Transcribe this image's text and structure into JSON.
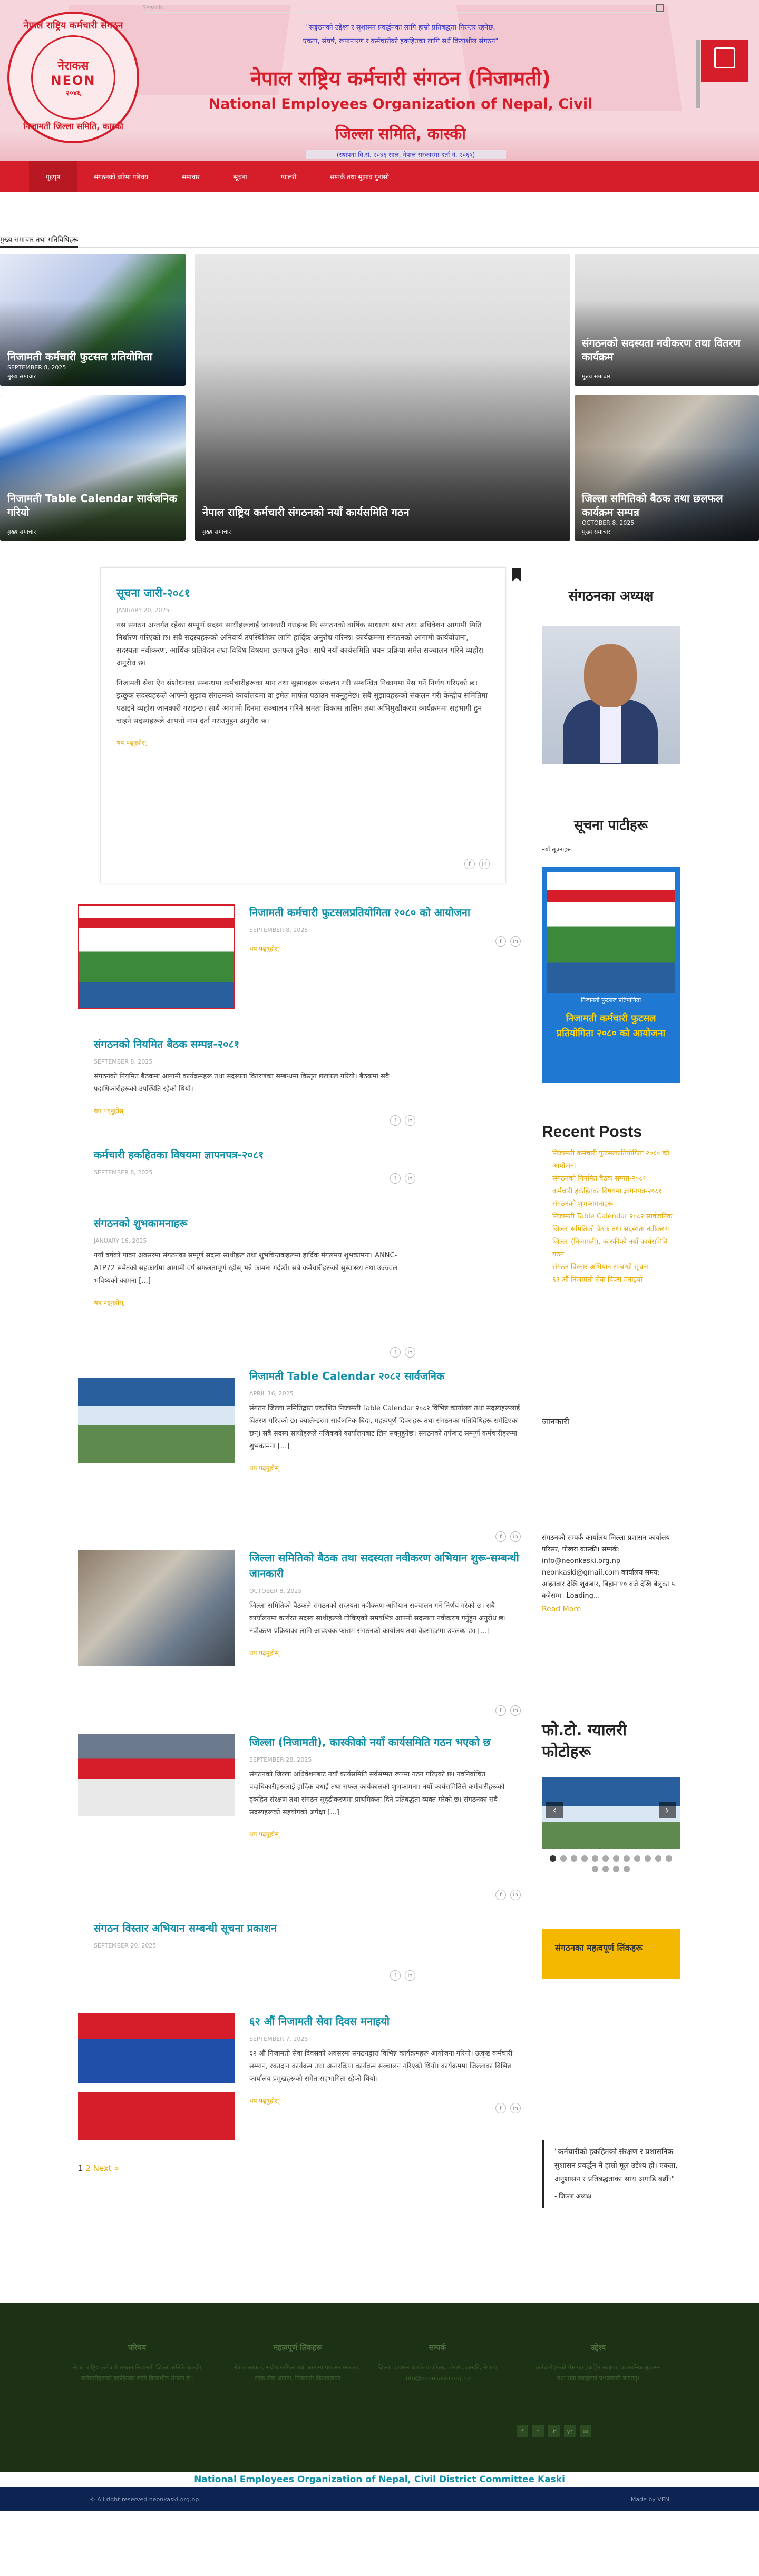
{
  "header": {
    "search_placeholder": "Search...",
    "logo": {
      "ring_top": "नेपाल राष्ट्रिय कर्मचारी संगठन",
      "abbr": "नेराकस",
      "neon": "NEON",
      "year": "२०४६",
      "ring_bottom": "निजामती जिल्ला समिति, कास्की"
    },
    "slogan_line1": "\"सङ्गठनको उद्देश्य र सुशासन प्रवर्द्धनका लागि हाम्रो प्रतिबद्धता निरन्तर रहनेछ,",
    "slogan_line2": "एकता, संघर्ष, रूपान्तरण र कर्मचारीको हकहितका लागि सधैँ क्रियाशील संगठन\"",
    "title_np": "नेपाल राष्ट्रिय कर्मचारी संगठन (निजामती)",
    "title_en": "National Employees Organization of Nepal, Civil",
    "title_sub": "जिल्ला समिति, कास्की",
    "estd": "(स्थापना वि.सं. २०४६ साल, नेपाल सरकारमा दर्ता नं. २०६५)"
  },
  "nav": [
    "गृहपृष्ठ",
    "संगठनको बारेमा परिचय",
    "समाचार",
    "सूचना",
    "ग्यालरी",
    "सम्पर्क तथा सुझाव गुनासो"
  ],
  "featured": {
    "section_title": "मुख्य समाचार तथा गतिविधिहरू",
    "cards": [
      {
        "title": "निजामती कर्मचारी फुटसल प्रतियोगिता",
        "date": "SEPTEMBER 8, 2025",
        "cat": "मुख्य समाचार"
      },
      {
        "title": "निजामती Table Calendar सार्वजनिक गरियो",
        "date": "",
        "cat": "मुख्य समाचार"
      },
      {
        "title": "नेपाल राष्ट्रिय कर्मचारी संगठनको नयाँ कार्यसमिति गठन",
        "date": "",
        "cat": "मुख्य समाचार"
      },
      {
        "title": "संगठनको सदस्यता नवीकरण तथा वितरण कार्यक्रम",
        "date": "",
        "cat": "मुख्य समाचार"
      },
      {
        "title": "जिल्ला समितिको बैठक तथा छलफल कार्यक्रम सम्पन्न",
        "date": "OCTOBER 8, 2025",
        "cat": "मुख्य समाचार"
      }
    ]
  },
  "lead": {
    "title": "सूचना जारी-२०८१",
    "date": "JANUARY 20, 2025",
    "para1": "यस संगठन अन्तर्गत रहेका सम्पूर्ण सदस्य साथीहरूलाई जानकारी गराइन्छ कि संगठनको वार्षिक साधारण सभा तथा अधिवेशन आगामी मिति निर्धारण गरिएको छ। सबै सदस्यहरूको अनिवार्य उपस्थितिका लागि हार्दिक अनुरोध गरिन्छ। कार्यक्रममा संगठनको आगामी कार्ययोजना, सदस्यता नवीकरण, आर्थिक प्रतिवेदन तथा विविध विषयमा छलफल हुनेछ। साथै नयाँ कार्यसमिति चयन प्रक्रिया समेत सञ्चालन गरिने व्यहोरा अनुरोध छ।",
    "para2": "निजामती सेवा ऐन संशोधनका सम्बन्धमा कर्मचारीहरूका माग तथा सुझावहरू संकलन गरी सम्बन्धित निकायमा पेस गर्ने निर्णय गरिएको छ। इच्छुक सदस्यहरूले आफ्नो सुझाव संगठनको कार्यालयमा वा इमेल मार्फत पठाउन सक्नुहुनेछ। सबै सुझावहरूको संकलन गरी केन्द्रीय समितिमा पठाइने व्यहोरा जानकारी गराइन्छ। साथै आगामी दिनमा सञ्चालन गरिने क्षमता विकास तालिम तथा अभिमुखीकरण कार्यक्रममा सहभागी हुन चाहने सदस्यहरूले आफ्नो नाम दर्ता गराउनुहुन अनुरोध छ।",
    "more": "थप पढ्नुहोस्"
  },
  "posts": [
    {
      "title": "निजामती कर्मचारी फुटसलप्रतियोगिता २०८० को आयोजना",
      "date": "SEPTEMBER 8, 2025",
      "excerpt": "",
      "more": "थप पढ्नुहोस्"
    },
    {
      "title": "संगठनको नियमित बैठक सम्पन्न-२०८१",
      "date": "SEPTEMBER 8, 2025",
      "excerpt": "संगठनको नियमित बैठकमा आगामी कार्यक्रमहरू तथा सदस्यता वितरणका सम्बन्धमा विस्तृत छलफल गरियो। बैठकमा सबै पदाधिकारीहरूको उपस्थिति रहेको थियो।",
      "more": "थप पढ्नुहोस्"
    },
    {
      "title": "कर्मचारी हकहितका विषयमा ज्ञापनपत्र-२०८१",
      "date": "SEPTEMBER 8, 2025",
      "excerpt": "",
      "more": ""
    },
    {
      "title": "संगठनको शुभकामनाहरू",
      "date": "JANUARY 16, 2025",
      "excerpt": "नयाँ वर्षको पावन अवसरमा संगठनका सम्पूर्ण सदस्य साथीहरू तथा शुभचिन्तकहरूमा हार्दिक मंगलमय शुभकामना। ANNC- ATP72 समेतको सहकार्यमा आगामी वर्ष सफलतापूर्ण रहोस् भन्ने कामना गर्दछौं। सबै कर्मचारीहरूको सुस्वास्थ्य तथा उज्ज्वल भविष्यको कामना [...]",
      "more": "थप पढ्नुहोस्"
    },
    {
      "title": "निजामती Table Calendar २०८२ सार्वजनिक",
      "date": "APRIL 16, 2025",
      "excerpt": "संगठन जिल्ला समितिद्वारा प्रकाशित निजामती Table Calendar २०८२ विभिन्न कार्यालय तथा सदस्यहरूलाई वितरण गरिएको छ। क्यालेन्डरमा सार्वजनिक बिदा, महत्वपूर्ण दिवसहरू तथा संगठनका गतिविधिहरू समेटिएका छन्। सबै सदस्य साथीहरूले नजिकको कार्यालयबाट लिन सक्नुहुनेछ। संगठनको तर्फबाट सम्पूर्ण कर्मचारीहरूमा शुभकामना [...]",
      "more": "थप पढ्नुहोस्"
    },
    {
      "title": "जिल्ला समितिको बैठक तथा सदस्यता नवीकरण अभियान शुरू-सम्बन्धी जानकारी",
      "date": "OCTOBER 8, 2025",
      "excerpt": "जिल्ला समितिको बैठकले संगठनको सदस्यता नवीकरण अभियान सञ्चालन गर्ने निर्णय गरेको छ। सबै कार्यालयमा कार्यरत सदस्य साथीहरूले तोकिएको समयभित्र आफ्नो सदस्यता नवीकरण गर्नुहुन अनुरोध छ। नवीकरण प्रक्रियाका लागि आवश्यक फाराम संगठनको कार्यालय तथा वेबसाइटमा उपलब्ध छ। [...]",
      "more": "थप पढ्नुहोस्"
    },
    {
      "title": "जिल्ला (निजामती), कास्कीको नयाँ कार्यसमिति गठन भएको छ",
      "date": "SEPTEMBER 28, 2025",
      "excerpt": "संगठनको जिल्ला अधिवेशनबाट नयाँ कार्यसमिति सर्वसम्मत रूपमा गठन गरिएको छ। नवनिर्वाचित पदाधिकारीहरूलाई हार्दिक बधाई तथा सफल कार्यकालको शुभकामना। नयाँ कार्यसमितिले कर्मचारीहरूको हकहित संरक्षण तथा संगठन सुदृढीकरणमा प्राथमिकता दिने प्रतिबद्धता व्यक्त गरेको छ। संगठनका सबै सदस्यहरूको सहयोगको अपेक्षा [...]",
      "more": "थप पढ्नुहोस्"
    },
    {
      "title": "संगठन विस्तार अभियान सम्बन्धी सूचना प्रकाशन",
      "date": "SEPTEMBER 20, 2025",
      "excerpt": "",
      "more": ""
    },
    {
      "title": "६२ औं निजामती सेवा दिवस मनाइयो",
      "date": "SEPTEMBER 7, 2025",
      "excerpt": "६२ औं निजामती सेवा दिवसको अवसरमा संगठनद्वारा विभिन्न कार्यक्रमहरू आयोजना गरियो। उत्कृष्ट कर्मचारी सम्मान, रक्तदान कार्यक्रम तथा अन्तरक्रिया कार्यक्रम सञ्चालन गरिएको थियो। कार्यक्रममा जिल्लाका विभिन्न कार्यालय प्रमुखहरूको समेत सहभागिता रहेको थियो।",
      "more": "थप पढ्नुहोस्"
    }
  ],
  "pagination": {
    "p1": "1",
    "p2": "2",
    "next": "Next »"
  },
  "sidebar": {
    "president_heading": "संगठनका अध्यक्ष",
    "notice_heading": "सूचना पाटीहरू",
    "notice_sub": "नयाँ सूचनाहरू",
    "ad_text": "निजामती कर्मचारी फुटसल प्रतियोगिता २०८० को आयोजना",
    "ad_sub": "निजामती फुटसल प्रतियोगिता",
    "recent_heading": "Recent Posts",
    "recent": [
      "निजामती कर्मचारी फुटसलप्रतियोगिता २०८० को आयोजना",
      "संगठनको नियमित बैठक सम्पन्न-२०८१",
      "कर्मचारी हकहितका विषयमा ज्ञापनपत्र-२०८१",
      "संगठनको शुभकामनाहरू",
      "निजामती Table Calendar २०८२ सार्वजनिक",
      "जिल्ला समितिको बैठक तथा सदस्यता नवीकरण",
      "जिल्ला (निजामती), कास्कीको नयाँ कार्यसमिति गठन",
      "संगठन विस्तार अभियान सम्बन्धी सूचना",
      "६२ औं निजामती सेवा दिवस मनाइयो"
    ],
    "info_heading": "जानकारी",
    "info_text": "संगठनको सम्पर्क कार्यालय जिल्ला प्रशासन कार्यालय परिसर, पोखरा कास्की। सम्पर्क: info@neonkaski.org.np neonkaski@gmail.com कार्यालय समय: आइतबार देखि शुक्रबार, बिहान १० बजे देखि बेलुका ५ बजेसम्म। Loading...",
    "readmore": "Read More",
    "gallery_heading": "फो.टो. ग्यालरी फोटोहरू",
    "yellow_box": "संगठनका महत्वपूर्ण लिंकहरू",
    "quote": "\"कर्मचारीको हकहितको संरक्षण र प्रशासनिक सुशासन प्रवर्द्धन नै हाम्रो मूल उद्देश्य हो। एकता, अनुशासन र प्रतिबद्धताका साथ अगाडि बढौँ।\"",
    "quote_cite": "- जिल्ला अध्यक्ष"
  },
  "footer": {
    "col1_h": "परिचय",
    "col1_t": "नेपाल राष्ट्रिय कर्मचारी संगठन निजामती जिल्ला समिति कास्की कर्मचारीहरूको हकहितका लागि क्रियाशील संगठन हो।",
    "col2_h": "महत्वपूर्ण लिंकहरू",
    "col2_t": "नेपाल सरकार, संघीय मामिला तथा सामान्य प्रशासन मन्त्रालय, लोक सेवा आयोग, निजामती किताबखाना",
    "col3_h": "सम्पर्क",
    "col3_t": "जिल्ला प्रशासन कार्यालय परिसर, पोखरा, कास्की, नेपाल। info@neonkaski.org.np",
    "col4_h": "उद्देश्य",
    "col4_t": "कर्मचारीहरूको पेसागत हकहित संरक्षण, प्रशासनिक सुशासन तथा सेवा प्रवाहलाई प्रभावकारी बनाउनु।",
    "social": [
      "f",
      "t",
      "in",
      "yt",
      "✉"
    ],
    "sub_title": "National Employees Organization of Nepal, Civil District Committee Kaski",
    "copyright": "© All right reserved neonkaski.org.np",
    "made_by": "Made by VEN"
  }
}
